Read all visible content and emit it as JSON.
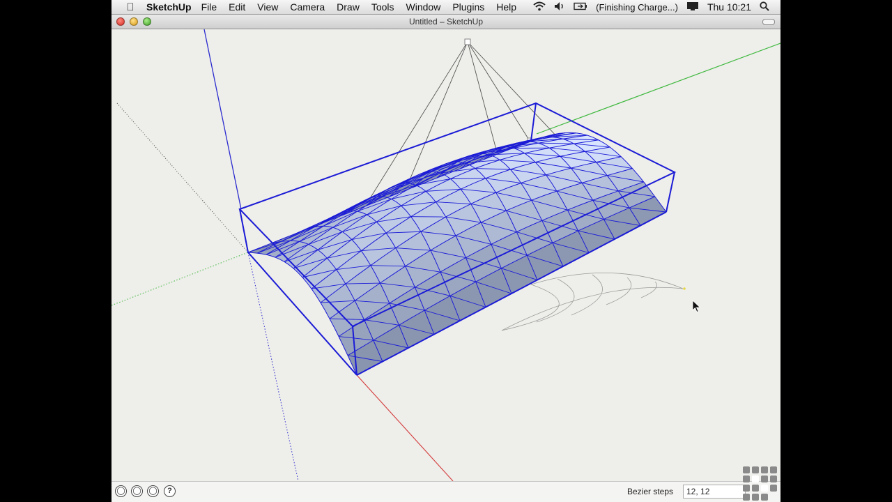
{
  "menubar": {
    "app_name": "SketchUp",
    "items": [
      "File",
      "Edit",
      "View",
      "Camera",
      "Draw",
      "Tools",
      "Window",
      "Plugins",
      "Help"
    ],
    "battery_status": "(Finishing Charge...)",
    "clock": "Thu 10:21"
  },
  "window": {
    "title": "Untitled – SketchUp"
  },
  "statusbar": {
    "icons": [
      "geolocation-icon",
      "credits-icon",
      "user-icon",
      "help-icon"
    ],
    "help_glyph": "?",
    "vcb_label": "Bezier steps",
    "vcb_value": "12, 12"
  },
  "colors": {
    "selection": "#1b1bd6",
    "axis_red": "#d33b3b",
    "axis_green": "#3cb83c",
    "axis_blue": "#2b2bd0"
  }
}
